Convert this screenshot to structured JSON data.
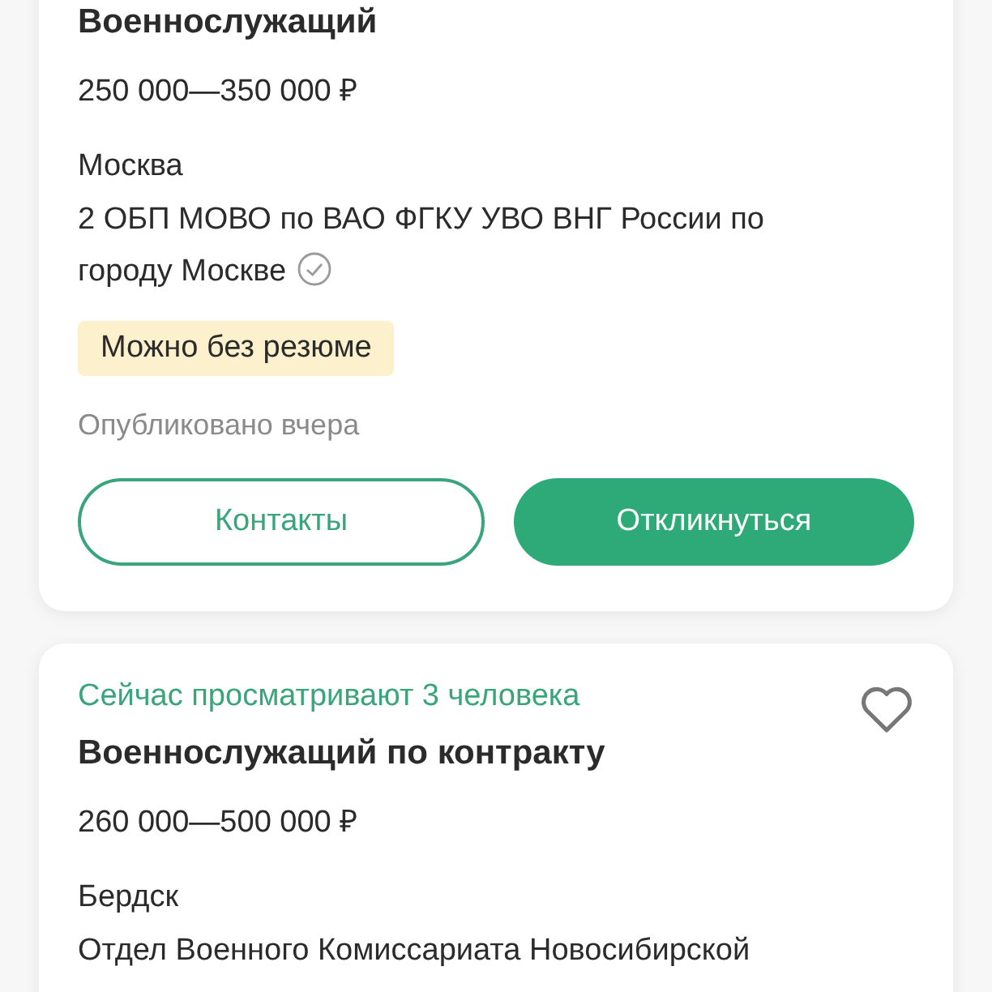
{
  "vacancies": [
    {
      "title": "Военнослужащий",
      "salary": "250 000—350 000 ₽",
      "city": "Москва",
      "company": "2 ОБП МОВО по ВАО ФГКУ УВО ВНГ России по городу Москве",
      "verified": true,
      "badge": "Можно без резюме",
      "published": "Опубликовано вчера",
      "buttons": [
        {
          "label": "Контакты",
          "kind": "outline"
        },
        {
          "label": "Откликнуться",
          "kind": "filled"
        }
      ]
    },
    {
      "viewers": "Сейчас просматривают 3 человека",
      "favorite": false,
      "title": "Военнослужащий по контракту",
      "salary": "260 000—500 000 ₽",
      "city": "Бердск",
      "company": "Отдел Военного Комиссариата Новосибирской",
      "verified": false
    }
  ]
}
